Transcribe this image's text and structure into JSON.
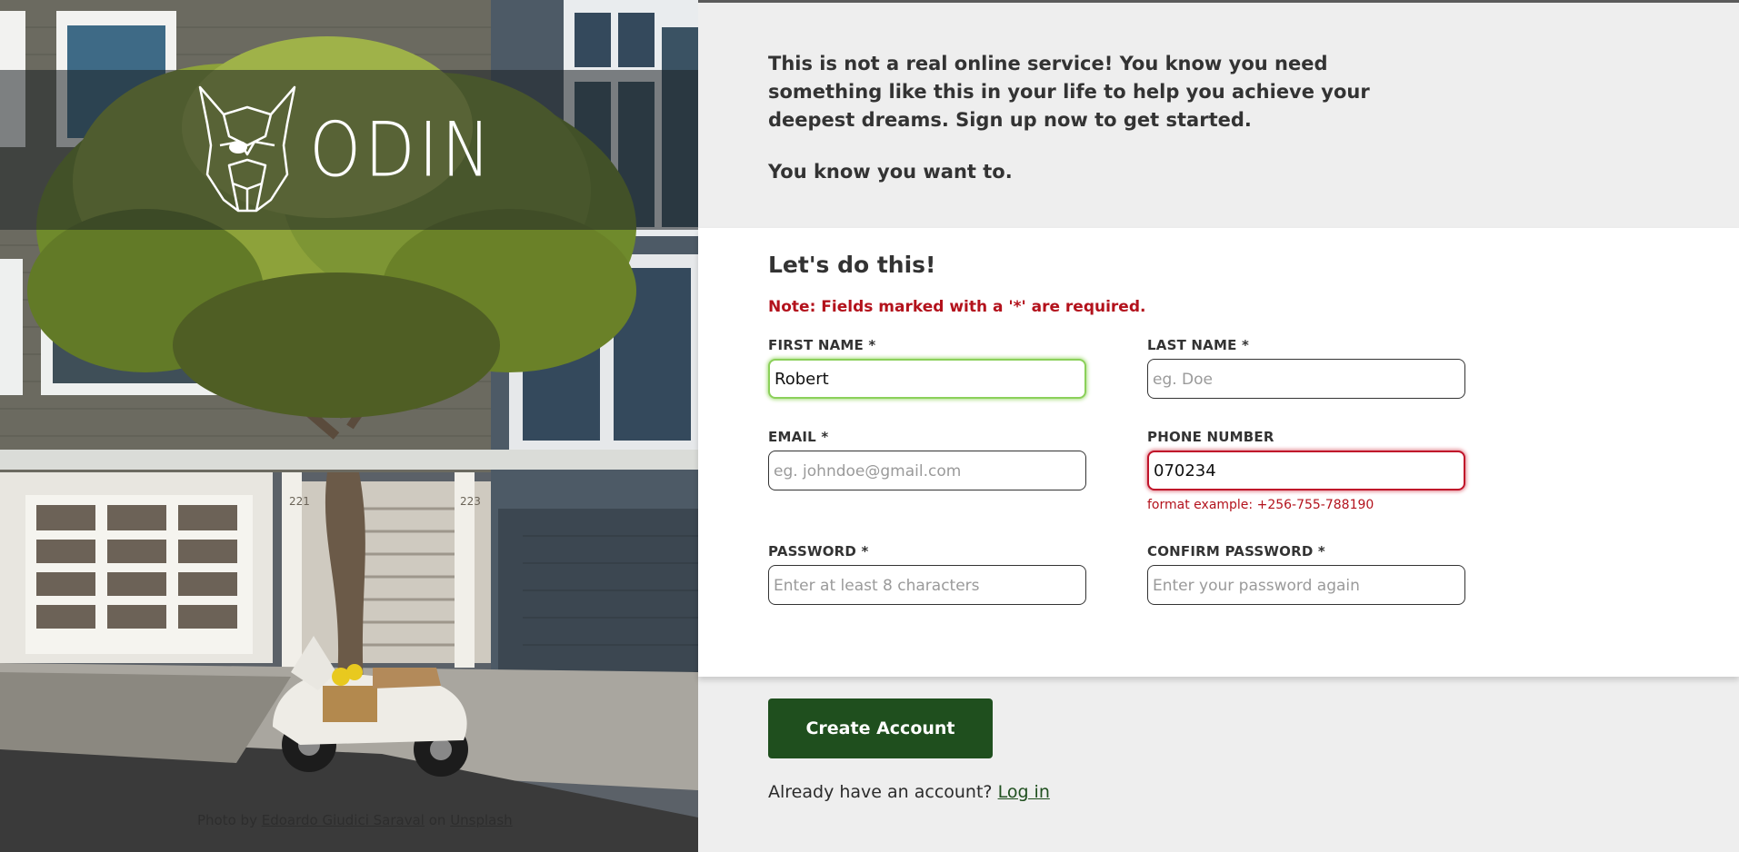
{
  "hero": {
    "logo_text": "ODIN",
    "credit_prefix": "Photo by ",
    "credit_author": "Edoardo Giudici Saraval",
    "credit_mid": " on ",
    "credit_site": "Unsplash",
    "house_number_left": "221",
    "house_number_right": "223"
  },
  "intro": {
    "paragraph1": "This is not a real online service! You know you need something like this in your life to help you achieve your deepest dreams. Sign up now to get started.",
    "paragraph2": "You know you want to."
  },
  "form": {
    "heading": "Let's do this!",
    "note": "Note: Fields marked with a '*' are required.",
    "first_name": {
      "label": "FIRST NAME *",
      "value": "Robert",
      "placeholder": "",
      "state": "valid"
    },
    "last_name": {
      "label": "LAST NAME *",
      "value": "",
      "placeholder": "eg. Doe"
    },
    "email": {
      "label": "EMAIL *",
      "value": "",
      "placeholder": "eg. johndoe@gmail.com"
    },
    "phone": {
      "label": "PHONE NUMBER",
      "value": "070234",
      "placeholder": "",
      "state": "invalid",
      "error": "format example: +256-755-788190"
    },
    "password": {
      "label": "PASSWORD *",
      "value": "",
      "placeholder": "Enter at least 8 characters"
    },
    "confirm_password": {
      "label": "CONFIRM PASSWORD *",
      "value": "",
      "placeholder": "Enter your password again"
    }
  },
  "actions": {
    "submit_label": "Create Account",
    "login_prompt": "Already have an account? ",
    "login_link": "Log in"
  },
  "colors": {
    "button": "#1f4f1e",
    "error": "#b3121c",
    "valid_border": "#8bd05a",
    "invalid_border": "#c0142a"
  }
}
